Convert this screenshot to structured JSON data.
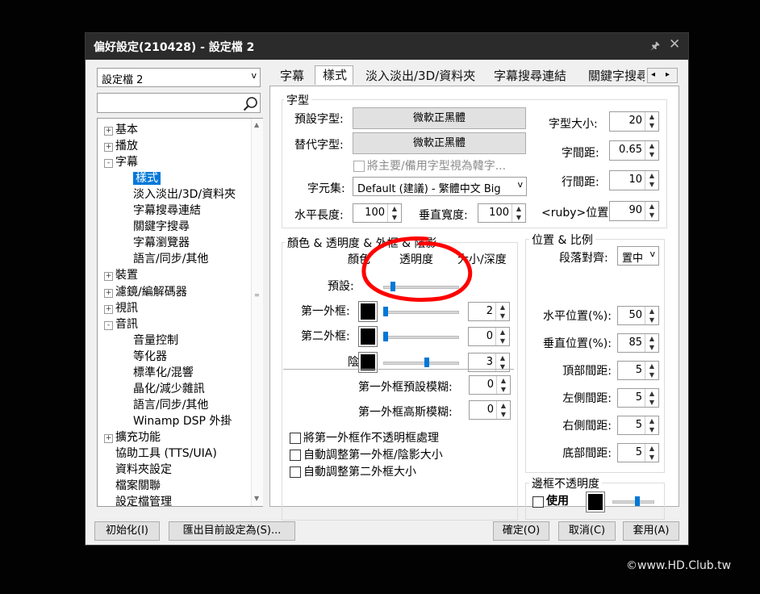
{
  "window": {
    "title": "偏好設定(210428) - 設定檔 2",
    "pin_glyph": "🖈",
    "close_glyph": "✕"
  },
  "profile_combo": {
    "value": "設定檔 2",
    "arrow": "v"
  },
  "search": {
    "placeholder": ""
  },
  "tree": [
    {
      "label": "基本",
      "expander": "+"
    },
    {
      "label": "播放",
      "expander": "+"
    },
    {
      "label": "字幕",
      "expander": "-"
    },
    {
      "label": "樣式",
      "selected": true
    },
    {
      "label": "淡入淡出/3D/資料夾"
    },
    {
      "label": "字幕搜尋連結"
    },
    {
      "label": "關鍵字搜尋"
    },
    {
      "label": "字幕瀏覽器"
    },
    {
      "label": "語言/同步/其他"
    },
    {
      "label": "裝置",
      "expander": "+"
    },
    {
      "label": "濾鏡/編解碼器",
      "expander": "+"
    },
    {
      "label": "視訊",
      "expander": "+"
    },
    {
      "label": "音訊",
      "expander": "-"
    },
    {
      "label": "音量控制"
    },
    {
      "label": "等化器"
    },
    {
      "label": "標準化/混響"
    },
    {
      "label": "晶化/減少雜訊"
    },
    {
      "label": "語言/同步/其他"
    },
    {
      "label": "Winamp DSP 外掛"
    },
    {
      "label": "擴充功能",
      "expander": "+"
    },
    {
      "label": "協助工具 (TTS/UIA)"
    },
    {
      "label": "資料夾設定"
    },
    {
      "label": "檔案關聯"
    },
    {
      "label": "設定檔管理"
    }
  ],
  "tabs": [
    "字幕",
    "樣式",
    "淡入淡出/3D/資料夾",
    "字幕搜尋連結",
    "關鍵字搜尋"
  ],
  "tab_scroll": {
    "left": "◂",
    "right": "▸"
  },
  "font_group": {
    "title": "字型",
    "default_font_label": "預設字型:",
    "default_font": "微軟正黑體",
    "alt_font_label": "替代字型:",
    "alt_font": "微軟正黑體",
    "korean_checkbox": "將主要/備用字型視為韓字...",
    "charset_label": "字元集:",
    "charset": "Default (建議) - 繁體中文 Big",
    "hlen_label": "水平長度:",
    "hlen": "100",
    "vwidth_label": "垂直寬度:",
    "vwidth": "100",
    "size_label": "字型大小:",
    "size": "20",
    "spacing_label": "字間距:",
    "spacing": "0.65",
    "linespacing_label": "行間距:",
    "linespacing": "10",
    "ruby_label": "<ruby>位置:",
    "ruby": "90"
  },
  "color_group": {
    "title": "顏色 & 透明度 & 外框 & 陰影",
    "col_color": "顏色",
    "col_opacity": "透明度",
    "col_size": "大小/深度",
    "rows": [
      {
        "label": "預設:",
        "value": "",
        "slider": 0.1
      },
      {
        "label": "第一外框:",
        "value": "2",
        "slider": 0.0
      },
      {
        "label": "第二外框:",
        "value": "0",
        "slider": 0.0
      },
      {
        "label": "陰影:",
        "value": "3",
        "slider": 0.55
      }
    ],
    "blur_default_label": "第一外框預設模糊:",
    "blur_default": "0",
    "blur_gauss_label": "第一外框高斯模糊:",
    "blur_gauss": "0",
    "checks": [
      "將第一外框作不透明框處理",
      "自動調整第一外框/陰影大小",
      "自動調整第二外框大小"
    ]
  },
  "position_group": {
    "title": "位置 & 比例",
    "align_label": "段落對齊:",
    "align": "置中",
    "hpos_label": "水平位置(%):",
    "hpos": "50",
    "vpos_label": "垂直位置(%):",
    "vpos": "85",
    "top_label": "頂部間距:",
    "top": "5",
    "left_label": "左側間距:",
    "left": "5",
    "right_label": "右側間距:",
    "right": "5",
    "bottom_label": "底部間距:",
    "bottom": "5"
  },
  "border_group": {
    "title": "邊框不透明度",
    "use_label": "使用",
    "slider": 0.55
  },
  "buttons": {
    "init": "初始化(I)",
    "export": "匯出目前設定為(S)...",
    "ok": "確定(O)",
    "cancel": "取消(C)",
    "apply": "套用(A)"
  },
  "annotation": {
    "color": "#ff0000",
    "shape": "hand-drawn circle"
  },
  "watermark": "©www.HD.Club.tw"
}
